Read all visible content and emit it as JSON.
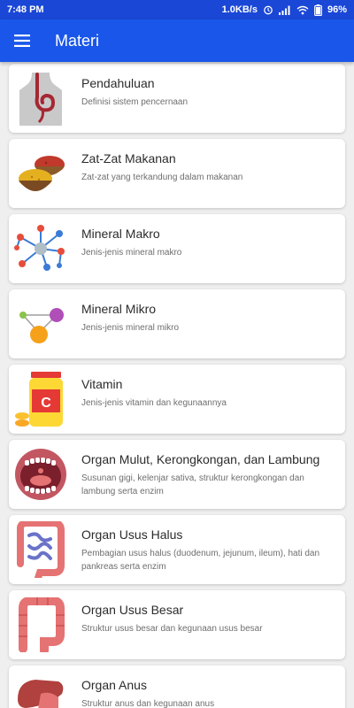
{
  "status": {
    "time": "7:48 PM",
    "speed": "1.0KB/s",
    "battery": "96%"
  },
  "appbar": {
    "title": "Materi",
    "menu_icon": "hamburger-menu-icon"
  },
  "items": [
    {
      "title": "Pendahuluan",
      "subtitle": "Definisi sistem pencernaan",
      "icon": "digestive-body-icon"
    },
    {
      "title": "Zat-Zat Makanan",
      "subtitle": "Zat-zat yang terkandung dalam makanan",
      "icon": "spice-bowls-icon"
    },
    {
      "title": "Mineral Makro",
      "subtitle": "Jenis-jenis mineral makro",
      "icon": "molecule-icon"
    },
    {
      "title": "Mineral Mikro",
      "subtitle": "Jenis-jenis mineral mikro",
      "icon": "molecule-small-icon"
    },
    {
      "title": "Vitamin",
      "subtitle": "Jenis-jenis vitamin dan kegunaannya",
      "icon": "vitamin-jar-icon"
    },
    {
      "title": "Organ Mulut, Kerongkongan, dan Lambung",
      "subtitle": "Susunan gigi, kelenjar sativa, struktur kerongkongan dan lambung serta enzim",
      "icon": "mouth-icon"
    },
    {
      "title": "Organ Usus Halus",
      "subtitle": "Pembagian usus halus (duodenum, jejunum, ileum), hati dan pankreas serta enzim",
      "icon": "small-intestine-icon"
    },
    {
      "title": "Organ Usus Besar",
      "subtitle": "Struktur usus besar dan kegunaan usus besar",
      "icon": "large-intestine-icon"
    },
    {
      "title": "Organ Anus",
      "subtitle": "Struktur anus dan kegunaan anus",
      "icon": "anus-organ-icon"
    }
  ]
}
